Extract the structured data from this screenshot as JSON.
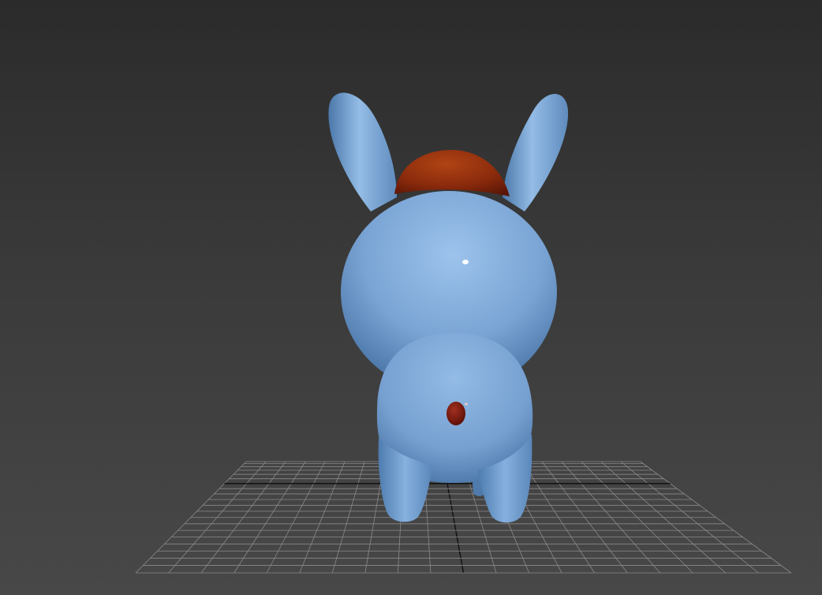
{
  "viewport": {
    "view": "back",
    "shading": "realistic",
    "grid_visible": true,
    "background_top": "#2b2b2b",
    "background_bottom": "#484848",
    "grid_color": "#8a8a8a",
    "grid_axis_color": "#111111"
  },
  "scene": {
    "objects": [
      {
        "name": "bunny-body",
        "color": "#7aa4d4"
      },
      {
        "name": "bunny-hair",
        "color": "#8a2a0c"
      },
      {
        "name": "bunny-tail",
        "color": "#6e1208"
      }
    ]
  }
}
